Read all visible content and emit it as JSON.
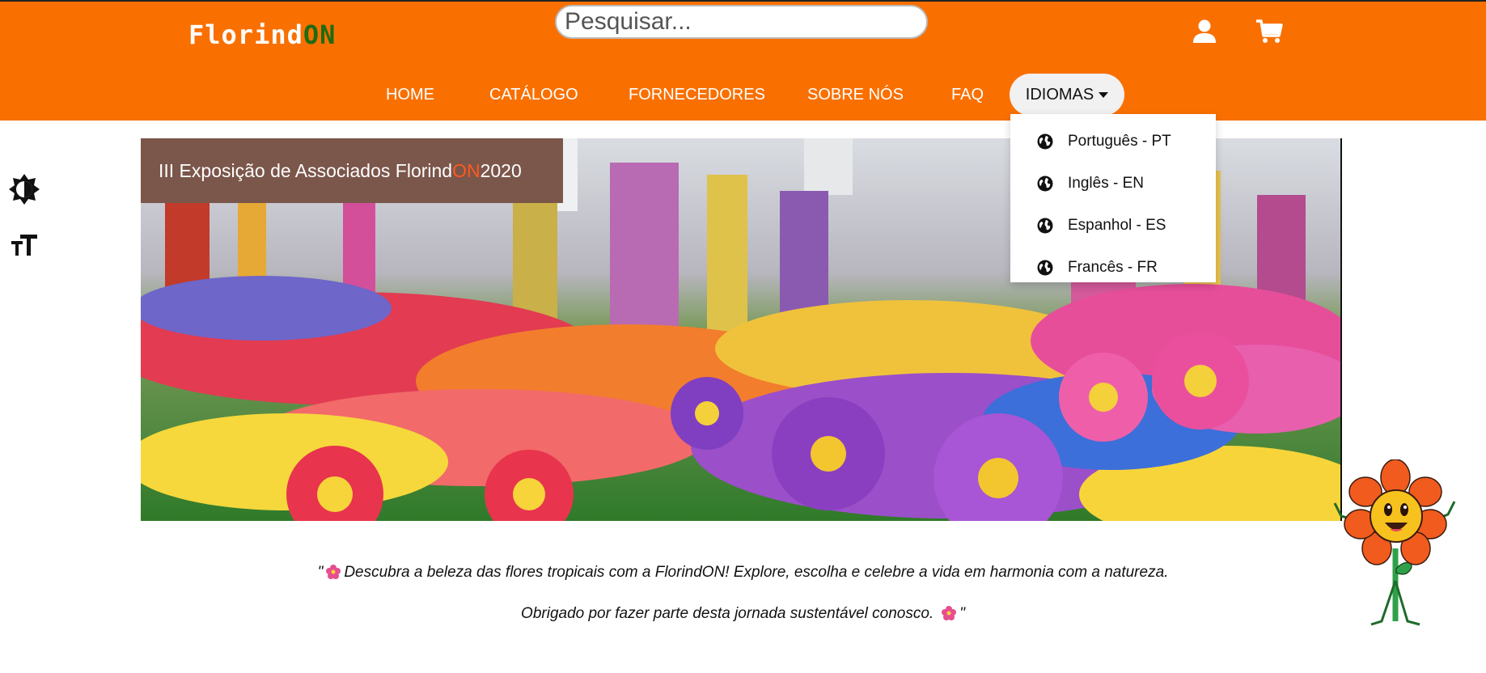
{
  "header": {
    "logo_main": "Florind",
    "logo_accent": "ON",
    "search_placeholder": "Pesquisar...",
    "icons": [
      "user-icon",
      "cart-icon"
    ]
  },
  "nav": {
    "items": [
      "HOME",
      "CATÁLOGO",
      "FORNECEDORES",
      "SOBRE NÓS",
      "FAQ"
    ],
    "language_label": "IDIOMAS"
  },
  "language_menu": {
    "items": [
      "Português - PT",
      "Inglês - EN",
      "Espanhol - ES",
      "Francês - FR"
    ],
    "icon": "globe-icon"
  },
  "tools": {
    "icons": [
      "contrast-icon",
      "text-size-icon"
    ]
  },
  "banner": {
    "caption_before": "III Exposição de Associados Florind",
    "caption_accent": "ON",
    "caption_after": " 2020"
  },
  "quote": {
    "line1_open": "\"",
    "line1_text": "Descubra a beleza das flores tropicais com a FlorindON! Explore, escolha e celebre a vida em harmonia com a natureza.",
    "line2_text": "Obrigado por fazer parte desta jornada sustentável conosco.",
    "line2_close": "\""
  },
  "colors": {
    "header_bg": "#f97001",
    "logo_accent": "#1e6b12",
    "caption_bg": "#7b564a",
    "caption_accent": "#ff5a1f"
  }
}
